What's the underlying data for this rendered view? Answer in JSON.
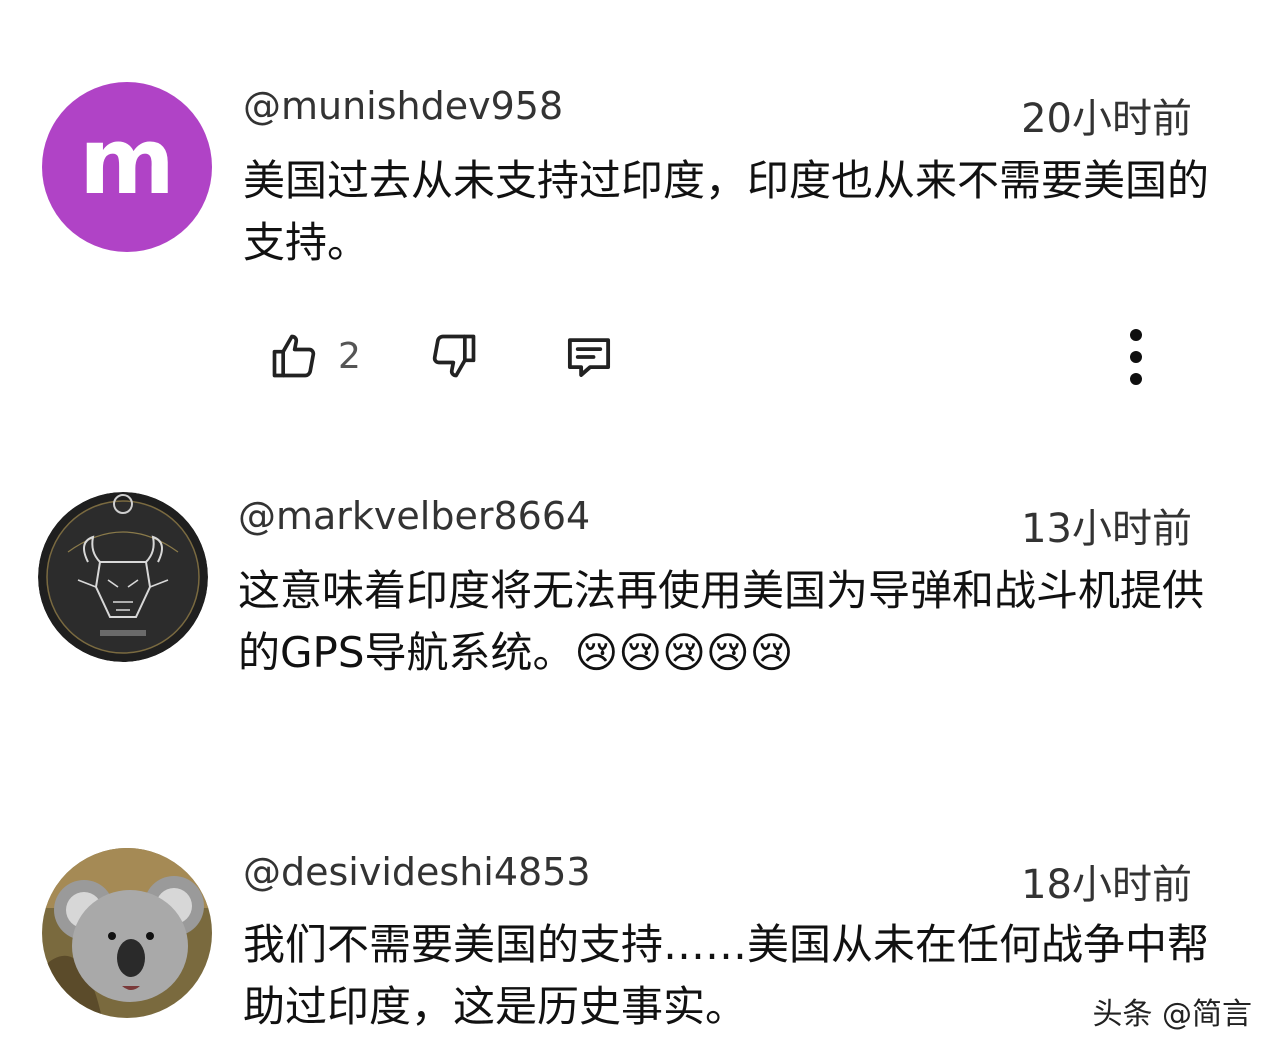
{
  "comments": [
    {
      "avatar_letter": "m",
      "handle": "@munishdev958",
      "time": "20小时前",
      "text": "美国过去从未支持过印度，印度也从来不需要美国的支持。",
      "like_count": "2",
      "avatar_color": "#b043c6"
    },
    {
      "handle": "@markvelber8664",
      "time": "13小时前",
      "text": "这意味着印度将无法再使用美国为导弹和战斗机提供的GPS导航系统。😢😢😢😢😢"
    },
    {
      "handle": "@desivideshi4853",
      "time": "18小时前",
      "text": "我们不需要美国的支持……美国从未在任何战争中帮助过印度，这是历史事实。"
    }
  ],
  "icons": {
    "like": "thumbs-up-icon",
    "dislike": "thumbs-down-icon",
    "reply": "reply-icon",
    "more": "more-vertical-icon"
  },
  "watermark": "头条 @简言"
}
